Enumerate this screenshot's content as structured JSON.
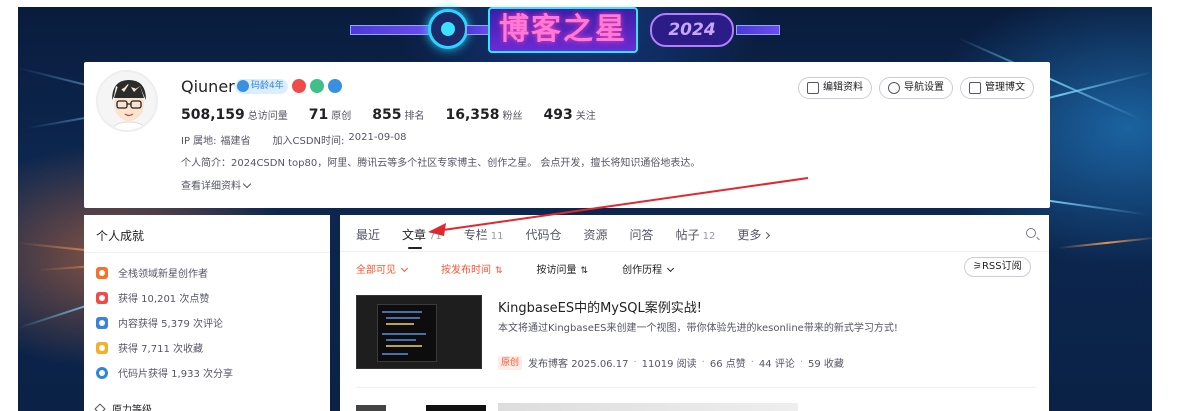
{
  "banner": {
    "title": "博客之星",
    "year": "2024"
  },
  "profile": {
    "username": "Qiuner",
    "code_age_badge": "码龄4年",
    "stats": [
      {
        "value": "508,159",
        "label": "总访问量"
      },
      {
        "value": "71",
        "label": "原创"
      },
      {
        "value": "855",
        "label": "排名"
      },
      {
        "value": "16,358",
        "label": "粉丝"
      },
      {
        "value": "493",
        "label": "关注"
      }
    ],
    "ip_label": "IP 属地:",
    "ip_value": "福建省",
    "join_label": "加入CSDN时间:",
    "join_value": "2021-09-08",
    "bio": "个人简介：2024CSDN top80，阿里、腾讯云等多个社区专家博主、创作之星。 会点开发，擅长将知识通俗地表达。",
    "detail_link": "查看详细资料",
    "buttons": {
      "edit": "编辑资料",
      "nav": "导航设置",
      "manage": "管理博文"
    }
  },
  "achievements": {
    "title": "个人成就",
    "items": [
      {
        "text": "全栈领域新星创作者",
        "color": "#f2722e"
      },
      {
        "text": "获得 10,201 次点赞",
        "color": "#ef4b4b"
      },
      {
        "text": "内容获得 5,379 次评论",
        "color": "#3b82e0"
      },
      {
        "text": "获得 7,711 次收藏",
        "color": "#f4b028"
      },
      {
        "text": "代码片获得 1,933 次分享",
        "color": "#2f86d6"
      }
    ],
    "next_section": "原力等级"
  },
  "tabs": [
    {
      "label": "最近",
      "count": ""
    },
    {
      "label": "文章",
      "count": "71"
    },
    {
      "label": "专栏",
      "count": "11"
    },
    {
      "label": "代码仓",
      "count": ""
    },
    {
      "label": "资源",
      "count": ""
    },
    {
      "label": "问答",
      "count": ""
    },
    {
      "label": "帖子",
      "count": "12"
    },
    {
      "label": "更多",
      "count": ""
    }
  ],
  "filters": {
    "visibility": "全部可见",
    "by_time": "按发布时间",
    "by_views": "按访问量",
    "history": "创作历程",
    "rss": "RSS订阅"
  },
  "article": {
    "title": "KingbaseES中的MySQL案例实战!",
    "desc": "本文将通过KingbaseES来创建一个视图，带你体验先进的kesonline带来的新式学习方式!",
    "tag": "原创",
    "published": "发布博客 2025.06.17",
    "reads": "11019 阅读",
    "likes": "66 点赞",
    "comments": "44 评论",
    "favorites": "59 收藏"
  },
  "colors": {
    "accent": "#fc5531",
    "annotation_arrow": "#e0282e"
  }
}
